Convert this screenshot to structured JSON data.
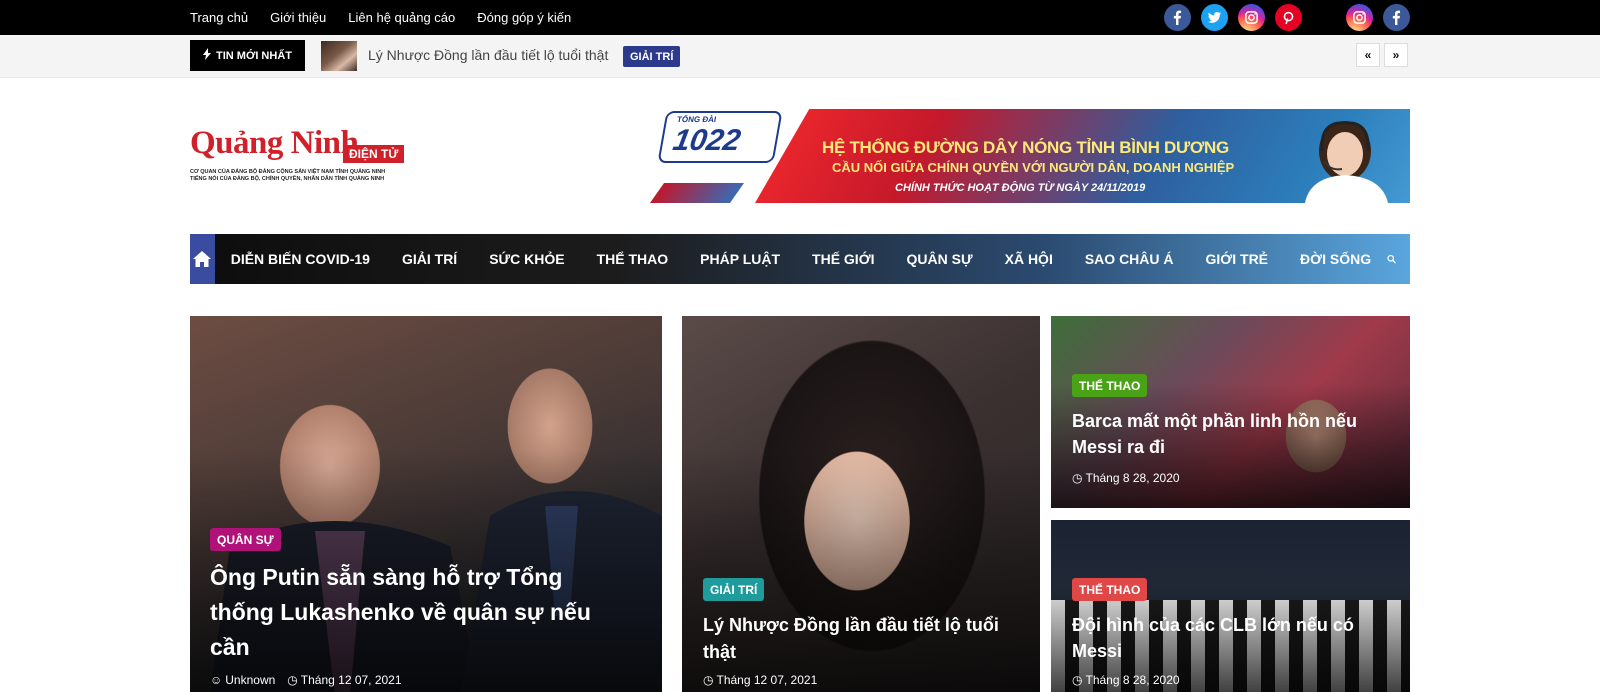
{
  "topbar": {
    "links": [
      "Trang chủ",
      "Giới thiệu",
      "Liên hệ quảng cáo",
      "Đóng góp ý kiến"
    ],
    "social_icons": [
      "facebook-icon",
      "twitter-icon",
      "instagram-icon",
      "pinterest-icon",
      "instagram-icon",
      "facebook-icon"
    ]
  },
  "ticker": {
    "label": "TIN MỚI NHẤT",
    "title": "Lý Nhược Đồng lần đầu tiết lộ tuổi thật",
    "badge": "GIẢI TRÍ",
    "prev": "«",
    "next": "»"
  },
  "logo": {
    "name": "Quảng Ninh",
    "sub": "ĐIỆN TỬ",
    "line1": "CƠ QUAN CỦA ĐẢNG BỘ ĐẢNG CỘNG SẢN VIỆT NAM TỈNH QUẢNG NINH",
    "line2": "TIẾNG NÓI CỦA ĐẢNG BỘ, CHÍNH QUYỀN, NHÂN DÂN TỈNH QUẢNG NINH"
  },
  "banner": {
    "logo_small": "TỔNG ĐÀI",
    "logo_number": "1022",
    "line1": "HỆ THỐNG ĐƯỜNG DÂY NÓNG TỈNH BÌNH DƯƠNG",
    "line2": "CẦU NỐI GIỮA CHÍNH QUYỀN VỚI NGƯỜI DÂN, DOANH NGHIỆP",
    "line3": "CHÍNH THỨC HOẠT ĐỘNG TỪ NGÀY 24/11/2019"
  },
  "nav": {
    "items": [
      "DIỄN BIẾN COVID-19",
      "GIẢI TRÍ",
      "SỨC KHỎE",
      "THỂ THAO",
      "PHÁP LUẬT",
      "THẾ GIỚI",
      "QUÂN SỰ",
      "XÃ HỘI",
      "SAO CHÂU Á",
      "GIỚI TRẺ",
      "ĐỜI SỐNG"
    ]
  },
  "articles": {
    "a1": {
      "category": "QUÂN SỰ",
      "title": "Ông Putin sẵn sàng hỗ trợ Tổng thống Lukashenko về quân sự nếu cần",
      "author": "Unknown",
      "date": "Tháng 12 07, 2021"
    },
    "a2": {
      "category": "GIẢI TRÍ",
      "title": "Lý Nhược Đồng lần đầu tiết lộ tuổi thật",
      "date": "Tháng 12 07, 2021"
    },
    "a3": {
      "category": "THỂ THAO",
      "title": "Barca mất một phần linh hồn nếu Messi ra đi",
      "date": "Tháng 8 28, 2020"
    },
    "a4": {
      "category": "THỂ THAO",
      "title": "Đội hình của các CLB lớn nếu có Messi",
      "date": "Tháng 8 28, 2020"
    }
  },
  "colors": {
    "quan_su": "#b0127a",
    "giai_tri": "#1f9b9b",
    "the_thao_green": "#4aa317",
    "the_thao_red": "#e04848",
    "ticker_badge": "#2b3a8a"
  }
}
